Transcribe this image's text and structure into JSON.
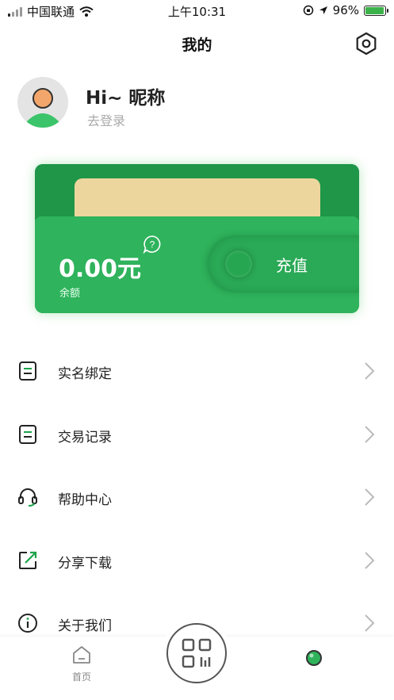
{
  "status_bar": {
    "carrier": "中国联通",
    "time": "上午10:31",
    "battery": "96%"
  },
  "header": {
    "title": "我的"
  },
  "profile": {
    "nickname": "Hi~ 昵称",
    "login_text": "去登录"
  },
  "wallet": {
    "balance": "0.00元",
    "balance_label": "余额",
    "recharge_label": "充值",
    "colors": {
      "primary": "#2fb35c",
      "paper": "#ecd69e"
    }
  },
  "menu": {
    "items": [
      {
        "label": "实名绑定",
        "icon": "document-icon"
      },
      {
        "label": "交易记录",
        "icon": "document-icon"
      },
      {
        "label": "帮助中心",
        "icon": "headset-icon"
      },
      {
        "label": "分享下载",
        "icon": "share-icon"
      },
      {
        "label": "关于我们",
        "icon": "info-icon"
      }
    ]
  },
  "tabbar": {
    "home_label": "首页"
  }
}
